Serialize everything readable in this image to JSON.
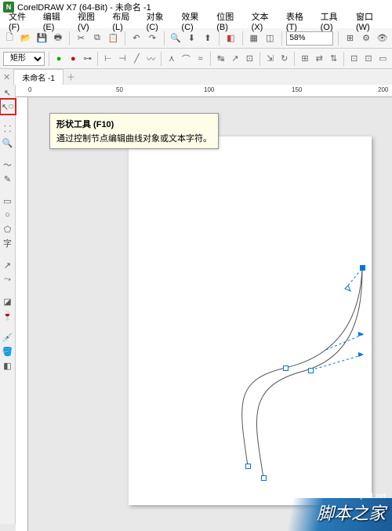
{
  "title": {
    "app": "CorelDRAW X7 (64-Bit) - 未命名 -1"
  },
  "menu": {
    "items": [
      "文件(F)",
      "编辑(E)",
      "视图(V)",
      "布局(L)",
      "对象(C)",
      "效果(C)",
      "位图(B)",
      "文本(X)",
      "表格(T)",
      "工具(O)",
      "窗口(W)"
    ]
  },
  "zoom": {
    "value": "58%"
  },
  "prop": {
    "shape": "矩形"
  },
  "doc": {
    "tab": "未命名 -1"
  },
  "ruler": {
    "ticks": [
      "0",
      "50",
      "100",
      "150",
      "200"
    ]
  },
  "tooltip": {
    "title": "形状工具 (F10)",
    "desc": "通过控制节点编辑曲线对象或文本字符。"
  },
  "watermark": {
    "brand": "脚本之家",
    "url": "jb51.net"
  }
}
